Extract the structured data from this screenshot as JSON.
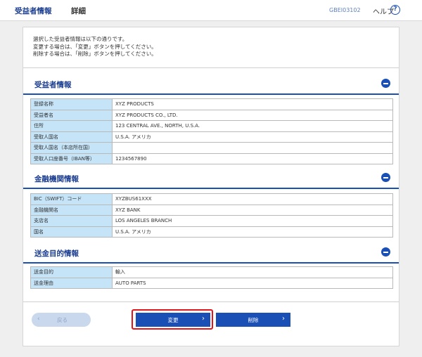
{
  "header": {
    "title": "受益者情報",
    "subtitle": "詳細",
    "screen_id": "GBEI03102",
    "help_label": "ヘルプ",
    "help_icon": "?"
  },
  "notice": {
    "lines": [
      "選択した受益者情報は以下の通りです。",
      "変更する場合は、「変更」ボタンを押してください。",
      "削除する場合は、「削除」ボタンを押してください。"
    ]
  },
  "sections": [
    {
      "title": "受益者情報",
      "rows": [
        {
          "label": "登録名称",
          "value": "XYZ PRODUCTS"
        },
        {
          "label": "受益者名",
          "value": "XYZ PRODUCTS CO., LTD."
        },
        {
          "label": "住所",
          "value": "123 CENTRAL AVE., NORTH, U.S.A."
        },
        {
          "label": "受取人国名",
          "value": "U.S.A. アメリカ"
        },
        {
          "label": "受取人国名（本店所在国）",
          "value": ""
        },
        {
          "label": "受取人口座番号（IBAN等）",
          "value": "1234567890"
        }
      ]
    },
    {
      "title": "金融機関情報",
      "rows": [
        {
          "label": "BIC（SWIFT）コード",
          "value": "XYZBUS61XXX"
        },
        {
          "label": "金融機関名",
          "value": "XYZ BANK"
        },
        {
          "label": "支店名",
          "value": "LOS ANGELES BRANCH"
        },
        {
          "label": "国名",
          "value": "U.S.A. アメリカ"
        }
      ]
    },
    {
      "title": "送金目的情報",
      "rows": [
        {
          "label": "送金目的",
          "value": "輸入"
        },
        {
          "label": "送金理由",
          "value": "AUTO PARTS"
        }
      ]
    }
  ],
  "buttons": {
    "back": "戻る",
    "change": "変更",
    "delete": "削除"
  }
}
